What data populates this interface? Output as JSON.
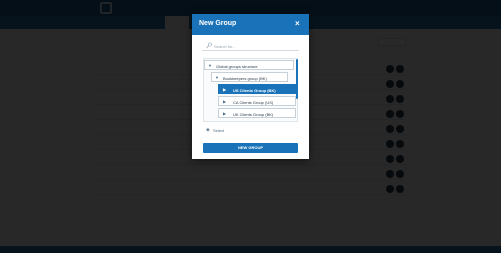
{
  "modal": {
    "title": "New Group",
    "close_glyph": "×",
    "search_placeholder": "Search for...",
    "tree": {
      "root_label": "Global groups structure",
      "group_label": "Bookkeepers group (BK)",
      "children": [
        {
          "label": "US Clients Group (BK)",
          "selected": true
        },
        {
          "label": "CA Clients Group (US)",
          "selected": false
        },
        {
          "label": "UK Clients Group (BK)",
          "selected": false
        }
      ]
    },
    "tag_label": "Select",
    "submit_label": "NEW GROUP"
  },
  "icons": {
    "search": "search-icon",
    "close": "close-icon",
    "caret_down": "chevron-down-icon",
    "caret_right": "chevron-right-icon",
    "tag": "tag-icon"
  },
  "colors": {
    "accent": "#1a73b9",
    "selected_node": "#1a73b9",
    "overlay": "#1b1f24"
  }
}
